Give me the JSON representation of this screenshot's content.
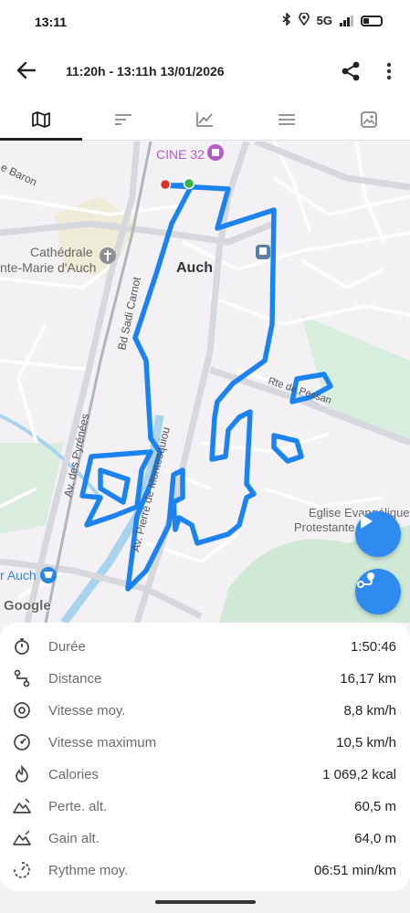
{
  "status": {
    "time": "13:11",
    "network": "5G"
  },
  "header": {
    "title": "11:20h - 13:11h  13/01/2026"
  },
  "tabs": [
    "map",
    "laps",
    "chart",
    "details",
    "photo"
  ],
  "map": {
    "labels": {
      "cine": "CINE 32",
      "cathedral1": "Cathédrale",
      "cathedral2": "nte-Marie d'Auch",
      "city": "Auch",
      "baron": "e Baron",
      "sadi": "Bd Sadi Carnot",
      "pyrenees": "Av. des Pyrénées",
      "montesquiou": "Av. Pierre de Montesquiou",
      "pessan": "Rte de Pessan",
      "eglise1": "Eglise Evangélique",
      "eglise2": "Protestante...",
      "shop": "r Auch",
      "google": "Google"
    },
    "route_color": "#1a83f0"
  },
  "stats": [
    {
      "icon": "timer-icon",
      "label": "Durée",
      "value": "1:50:46"
    },
    {
      "icon": "distance-icon",
      "label": "Distance",
      "value": "16,17 km"
    },
    {
      "icon": "speed-icon",
      "label": "Vitesse moy.",
      "value": "8,8 km/h"
    },
    {
      "icon": "max-speed-icon",
      "label": "Vitesse maximum",
      "value": "10,5 km/h"
    },
    {
      "icon": "calories-icon",
      "label": "Calories",
      "value": "1 069,2 kcal"
    },
    {
      "icon": "descent-icon",
      "label": "Perte. alt.",
      "value": "60,5 m"
    },
    {
      "icon": "ascent-icon",
      "label": "Gain alt.",
      "value": "64,0 m"
    },
    {
      "icon": "pace-icon",
      "label": "Rythme moy.",
      "value": "06:51 min/km"
    }
  ]
}
